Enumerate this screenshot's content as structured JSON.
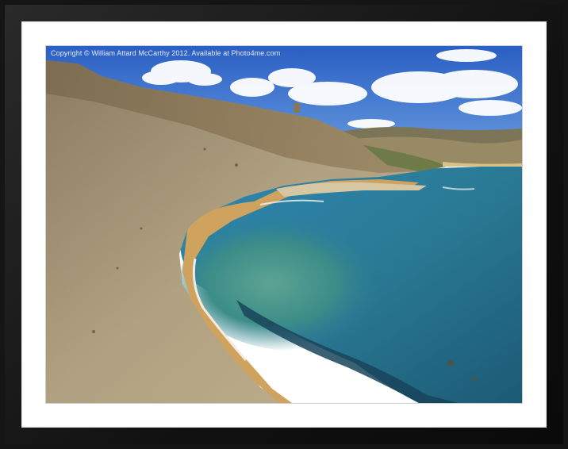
{
  "watermark": {
    "text": "Copyright © William Attard McCarthy 2012. Available at Photo4me.com"
  },
  "colors": {
    "frame": "#151515",
    "mat": "#ffffff",
    "sky": "#2f67c8",
    "sea_deep": "#2a7ea0",
    "sea_shallow": "#3f8f7e",
    "cliff": "#a99a7a",
    "sand": "#d9b46a"
  }
}
